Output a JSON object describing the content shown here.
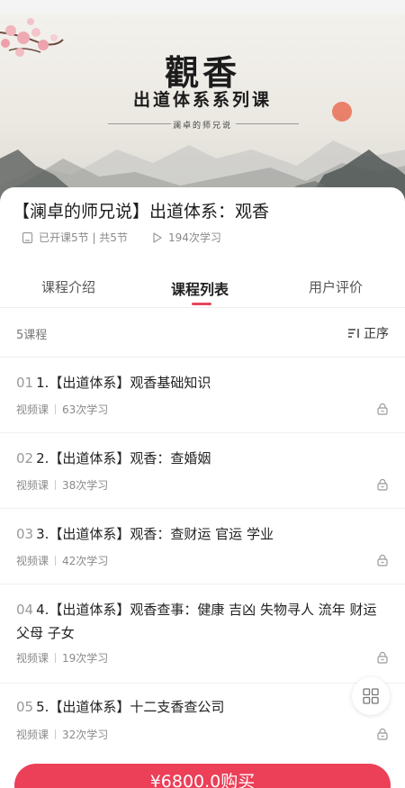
{
  "banner": {
    "title": "觀香",
    "subtitle": "出道体系系列课",
    "sign": "澜卓的师兄说"
  },
  "course": {
    "title": "【澜卓的师兄说】出道体系：观香",
    "progress_text": "已开课5节 | 共5节",
    "views_text": "194次学习"
  },
  "tabs": [
    {
      "label": "课程介绍"
    },
    {
      "label": "课程列表"
    },
    {
      "label": "用户评价"
    }
  ],
  "list": {
    "count": "5课程",
    "sort_label": "正序",
    "lessons": [
      {
        "num": "01",
        "title": "1.【出道体系】观香基础知识",
        "type": "视频课",
        "views": "63次学习"
      },
      {
        "num": "02",
        "title": "2.【出道体系】观香：查婚姻",
        "type": "视频课",
        "views": "38次学习"
      },
      {
        "num": "03",
        "title": "3.【出道体系】观香：查财运 官运 学业",
        "type": "视频课",
        "views": "42次学习"
      },
      {
        "num": "04",
        "title": "4.【出道体系】观香查事：健康 吉凶 失物寻人 流年 财运 父母 子女",
        "type": "视频课",
        "views": "19次学习"
      },
      {
        "num": "05",
        "title": "5.【出道体系】十二支香查公司",
        "type": "视频课",
        "views": "32次学习"
      }
    ]
  },
  "buy_button": "¥6800.0购买",
  "colors": {
    "accent": "#ec3f58",
    "tab_underline": "#e8475f"
  }
}
